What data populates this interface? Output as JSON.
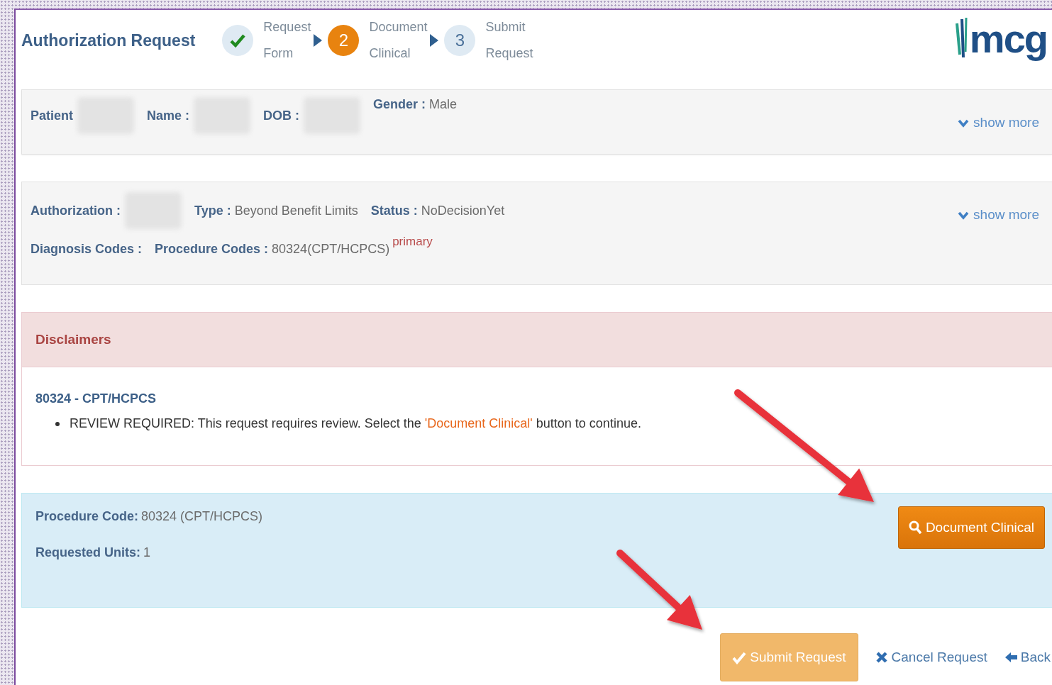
{
  "header": {
    "title": "Authorization Request",
    "logo": "mcg",
    "steps": [
      {
        "label": "Request Form",
        "completed": true
      },
      {
        "number": "2",
        "label": "Document Clinical",
        "completed": false,
        "current": true
      },
      {
        "number": "3",
        "label": "Submit Request",
        "completed": false,
        "current": false
      }
    ]
  },
  "patient_panel": {
    "fields": [
      {
        "label": "Patient",
        "redacted": true
      },
      {
        "label": "Name :",
        "redacted": true
      },
      {
        "label": "DOB :",
        "redacted": true
      },
      {
        "label": "Gender :",
        "value": "Male"
      }
    ],
    "show_more": "show more"
  },
  "authorization_panel": {
    "rows": [
      [
        {
          "label": "Authorization :",
          "redacted": true
        },
        {
          "label": "Type :",
          "value": "Beyond Benefit Limits"
        },
        {
          "label": "Status :",
          "value": "NoDecisionYet"
        }
      ],
      [
        {
          "label": "Diagnosis Codes :"
        },
        {
          "label": "Procedure Codes :",
          "value": "80324(CPT/HCPCS)",
          "tag": "primary"
        }
      ]
    ],
    "show_more": "show more"
  },
  "disclaimers": {
    "title": "Disclaimers",
    "heading": "80324 - CPT/HCPCS",
    "items": [
      {
        "before": "REVIEW REQUIRED: This request requires review. Select the ",
        "highlight": "'Document Clinical'",
        "after": " button to continue."
      }
    ]
  },
  "procedure_panel": {
    "fields": [
      {
        "label": "Procedure Code:",
        "value": "80324 (CPT/HCPCS)"
      },
      {
        "label": "Requested Units:",
        "value": "1"
      }
    ],
    "button": "Document Clinical"
  },
  "actions": [
    {
      "kind": "primary",
      "label": "Submit Request",
      "disabled": true
    },
    {
      "kind": "cancel",
      "label": "Cancel Request",
      "disabled": false
    },
    {
      "kind": "back",
      "label": "Back",
      "disabled": false
    }
  ]
}
